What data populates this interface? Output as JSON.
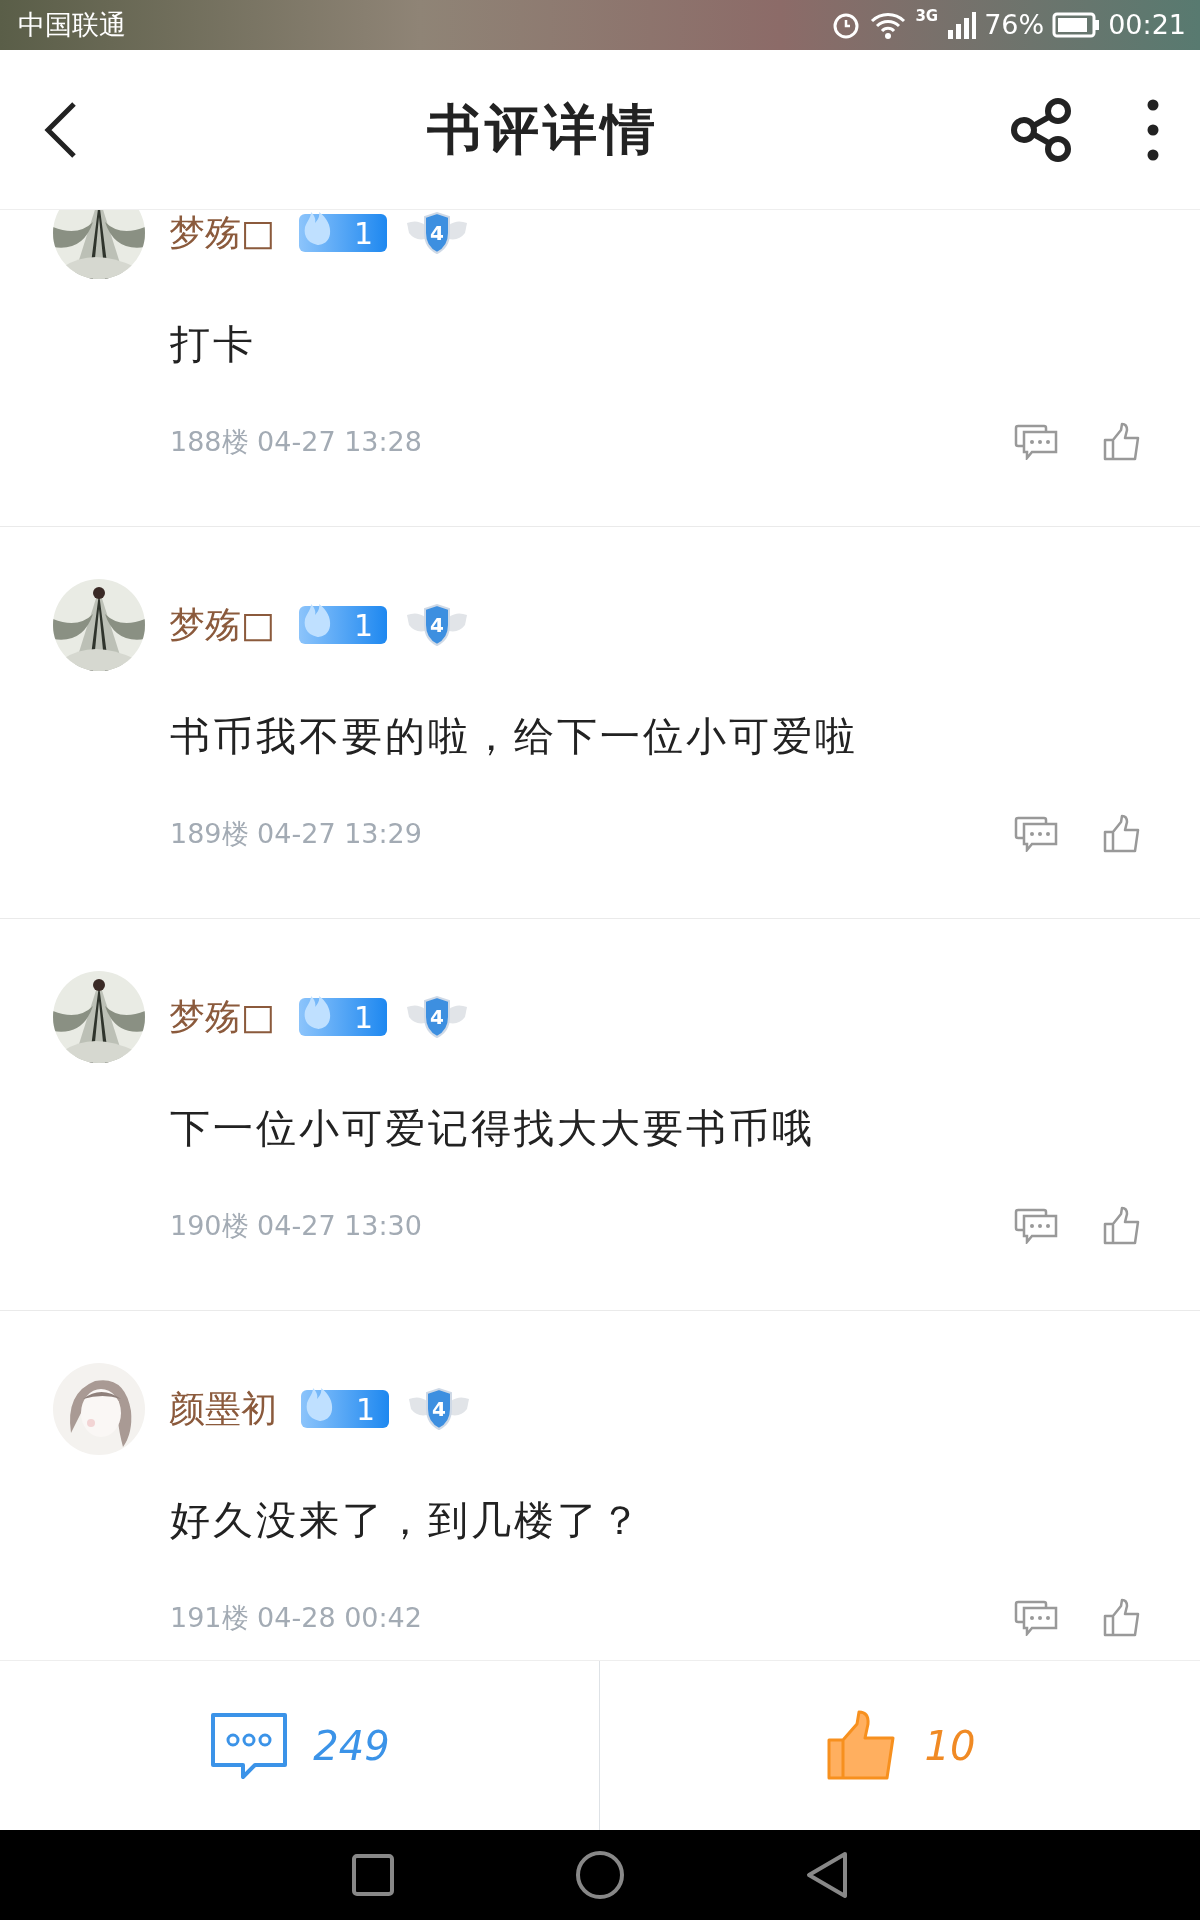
{
  "status_bar": {
    "carrier": "中国联通",
    "network": "3G",
    "battery": "76%",
    "time": "00:21"
  },
  "header": {
    "title": "书评详情"
  },
  "comments": [
    {
      "kind": "ink",
      "name": "梦殇□",
      "fire": "1",
      "rank": "4",
      "body": "打卡",
      "meta": "188楼 04-27 13:28"
    },
    {
      "kind": "ink",
      "name": "梦殇□",
      "fire": "1",
      "rank": "4",
      "body": "书币我不要的啦，给下一位小可爱啦",
      "meta": "189楼 04-27 13:29"
    },
    {
      "kind": "ink",
      "name": "梦殇□",
      "fire": "1",
      "rank": "4",
      "body": "下一位小可爱记得找大大要书币哦",
      "meta": "190楼 04-27 13:30"
    },
    {
      "kind": "sketch",
      "name": "颜墨初",
      "fire": "1",
      "rank": "4",
      "body": "好久没来了，到几楼了？",
      "meta": "191楼 04-28 00:42"
    }
  ],
  "footer": {
    "comment_count": "249",
    "like_count": "10"
  }
}
